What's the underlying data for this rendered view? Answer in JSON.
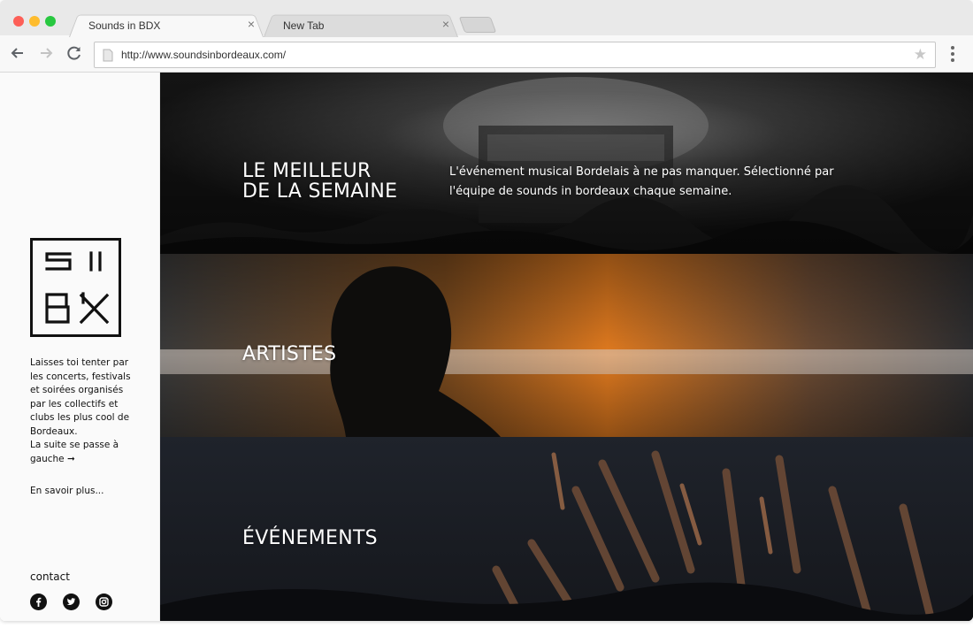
{
  "browser": {
    "tabs": [
      {
        "label": "Sounds in BDX",
        "close": "×"
      },
      {
        "label": "New Tab",
        "close": "×"
      }
    ],
    "url": "http://www.soundsinbordeaux.com/",
    "star": "★"
  },
  "sidebar": {
    "logo_alt": "SI BDX",
    "intro": "Laisses toi tenter par les concerts, festivals et soirées organisés par les collectifs et clubs les plus cool de Bordeaux.\nLa suite se passe à gauche ➞",
    "more_link": "En savoir plus...",
    "contact": "contact",
    "social": [
      "facebook-icon",
      "twitter-icon",
      "instagram-icon"
    ]
  },
  "main": {
    "sections": [
      {
        "title": "LE MEILLEUR\nDE LA SEMAINE",
        "description": "L'événement musical Bordelais à ne pas manquer. Sélectionné par l'équipe de sounds in bordeaux chaque semaine."
      },
      {
        "title": "ARTISTES"
      },
      {
        "title": "ÉVÉNEMENTS"
      }
    ]
  },
  "colors": {
    "accent_orange": "#e07a1f",
    "text_dark": "#111111",
    "chrome_bg": "#e9e9e9"
  }
}
